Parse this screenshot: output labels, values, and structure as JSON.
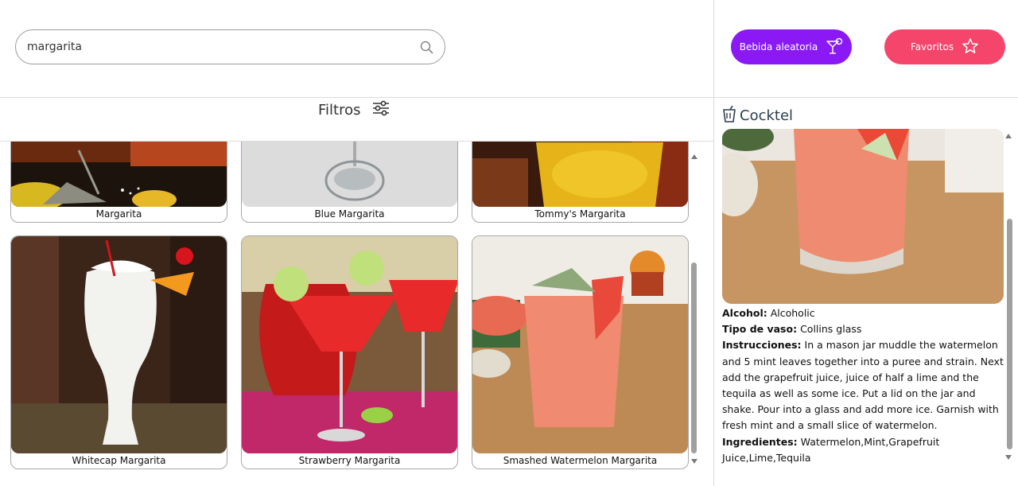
{
  "search": {
    "value": "margarita",
    "placeholder": ""
  },
  "filters": {
    "label": "Filtros"
  },
  "cards": [
    {
      "name": "Margarita"
    },
    {
      "name": "Blue Margarita"
    },
    {
      "name": "Tommy's Margarita"
    },
    {
      "name": "Whitecap Margarita"
    },
    {
      "name": "Strawberry Margarita"
    },
    {
      "name": "Smashed Watermelon Margarita"
    }
  ],
  "buttons": {
    "random": "Bebida aleatoria",
    "favorites": "Favoritos"
  },
  "detail": {
    "title": "Cocktel",
    "alcohol_label": "Alcohol:",
    "alcohol": "Alcoholic",
    "glass_label": "Tipo de vaso:",
    "glass": "Collins glass",
    "instructions_label": "Instrucciones:",
    "instructions": "In a mason jar muddle the watermelon and 5 mint leaves together into a puree and strain. Next add the grapefruit juice, juice of half a lime and the tequila as well as some ice. Put a lid on the jar and shake. Pour into a glass and add more ice. Garnish with fresh mint and a small slice of watermelon.",
    "ingredients_label": "Ingredientes:",
    "ingredients": "Watermelon,Mint,Grapefruit Juice,Lime,Tequila"
  },
  "colors": {
    "random_button": "#8a19f5",
    "favorites_button": "#f5456b"
  }
}
